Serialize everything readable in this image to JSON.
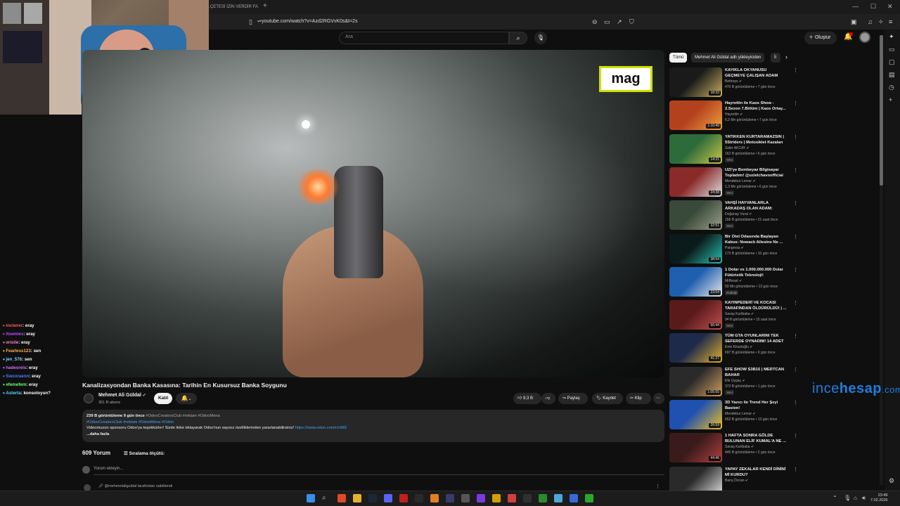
{
  "browser": {
    "tab_title": "YA ÇETESİ İZİN VERDİR FA",
    "url": "youtube.com/watch?v=Azd2RGVvK0s&t=2s"
  },
  "yt_header": {
    "search_placeholder": "Ara",
    "create_label": "Oluştur"
  },
  "chat": [
    {
      "user": "inciwrer",
      "msg": ": eray",
      "color": "#ff5a5a"
    },
    {
      "user": "itsemtex",
      "msg": ": eray",
      "color": "#b44cff"
    },
    {
      "user": "erisile",
      "msg": ": eray",
      "color": "#ff7dd0"
    },
    {
      "user": "Fearless123",
      "msg": ": sen",
      "color": "#ffb14a"
    },
    {
      "user": "jen_576",
      "msg": ": sen",
      "color": "#7ad7ff"
    },
    {
      "user": "hadesreis",
      "msg": ": eray",
      "color": "#d16cff"
    },
    {
      "user": "Swoxraenn",
      "msg": ": eray",
      "color": "#4a7bff"
    },
    {
      "user": "efemefem",
      "msg": ": eray",
      "color": "#6cff6c"
    },
    {
      "user": "Asterta",
      "msg": ": konsoloyun?",
      "color": "#57d8ff"
    }
  ],
  "video": {
    "logo_text": "mag",
    "title": "Kanalizasyondan Banka Kasasına: Tarihin En Kusursuz Banka Soygunu"
  },
  "channel": {
    "name": "Mehmet Ali Güldal",
    "subs": "351 B abone",
    "join_label": "Katıl"
  },
  "actions": {
    "likes": "9,3 B",
    "share": "Paylaş",
    "save": "Kaydet",
    "clip": "Klip"
  },
  "description": {
    "stats": "239 B görüntüleme  9 gün önce",
    "tags_inline": "#OdooCreatorsClub #reklam #OdooMena",
    "tags_line": "#OdooCreatorsClub #reklam #OdooMena #Odoo",
    "text": "Videomuzun sponsoru Odoo'ya teşekkürler! Sizde linke tıklayarak Odoo'nun sayısız özelliklerinden yararlanabilirsiniz!",
    "link": "https://www.odoo.com/r/ctM9",
    "more": "...daha fazla"
  },
  "comments": {
    "count": "609 Yorum",
    "sort_label": "Sıralama ölçütü:",
    "placeholder": "Yorum ekleyin...",
    "pinned": "@mehmetaliguldal tarafından sabitlendi"
  },
  "sidebar": {
    "chips": [
      "Tümü",
      "Mehmet Ali Güldal adlı yükleyiciden",
      "İl"
    ],
    "recs": [
      {
        "title": "KAYIKLA OKYANUSU GEÇMEYE ÇALIŞAN ADAM",
        "channel": "Bettrops",
        "meta": "470 B görüntüleme • 7 gün önce",
        "dur": "18:33",
        "badge": "",
        "c1": "#1a1a1a",
        "c2": "#c9b060"
      },
      {
        "title": "Hayrettin ile Kaos Show - 2.Sezon 7.Bölüm | Kaos Ortay...",
        "channel": "Hayrettin",
        "meta": "6,2 Mn görüntüleme • 7 gün önce",
        "dur": "1:10:49",
        "badge": "",
        "c1": "#b4411e",
        "c2": "#f0a040"
      },
      {
        "title": "YATIKKEN KURTARAMAZSIN | 5Striders | Motosiklet Kazaları ...",
        "channel": "Zafer AKCAY",
        "meta": "162 B görüntüleme • 6 gün önce",
        "dur": "14:21",
        "badge": "Yeni",
        "c1": "#2e6b3a",
        "c2": "#c9c94a"
      },
      {
        "title": "UZI'ye Bembeyaz Bilgisayar Topladım! @uzielchavoofficial",
        "channel": "Mendebur Lemur",
        "meta": "1,3 Mn görüntüleme • 6 gün önce",
        "dur": "24:38",
        "badge": "Yeni",
        "c1": "#8a2a2a",
        "c2": "#e0e0e0"
      },
      {
        "title": "VAHŞİ HAYVANLARLA ARKADAŞ OLAN ADAM: ÇOBA...",
        "channel": "Doğanay Vural",
        "meta": "156 B görüntüleme • 21 saat önce",
        "dur": "32:51",
        "badge": "Yeni",
        "c1": "#3a4a3a",
        "c2": "#9aa08a"
      },
      {
        "title": "Bir Otel Odasında Başlayan Kabus: Nowack Ailesine Ne ...",
        "channel": "Pangresa",
        "meta": "173 B görüntüleme • 10 gün önce",
        "dur": "38:54",
        "badge": "",
        "c1": "#0b1a1a",
        "c2": "#28c0b0"
      },
      {
        "title": "1 Dolar vs 1.000.000.000 Dolar Fütüristik Teknoloji!",
        "channel": "MrBeast",
        "meta": "93 Mn görüntüleme • 13 gün önce",
        "dur": "23:04",
        "badge": "Dublajlı",
        "c1": "#1e5fb0",
        "c2": "#e8e8e8"
      },
      {
        "title": "KAYINPEDERİ VE KOCASI TARAFINDAN ÖLDÜRÜLDÜ! | ...",
        "channel": "Savaş Kurtbaba",
        "meta": "94 B görüntüleme • 15 saat önce",
        "dur": "56:44",
        "badge": "Yeni",
        "c1": "#5a1a1a",
        "c2": "#c05050"
      },
      {
        "title": "TÜM GTA OYUNLARINI TEK SEFERDE OYNADIM! 14 ADET ...",
        "channel": "Emir Kiraztoğlu",
        "meta": "697 B görüntüleme • 9 gün önce",
        "dur": "41:27",
        "badge": "",
        "c1": "#1e2a4a",
        "c2": "#e0b030"
      },
      {
        "title": "EFE SHOW S3B15 | MERTCAN BAHAR",
        "channel": "Efe Uygaç",
        "meta": "372 B görüntüleme • 1 gün önce",
        "dur": "1:05:55",
        "badge": "Yeni",
        "c1": "#2a2a2a",
        "c2": "#d0a060"
      },
      {
        "title": "3D Yazıcı ile Trend Her Şeyi Bastım!",
        "channel": "Mendebur Lemur",
        "meta": "652 B görüntüleme • 13 gün önce",
        "dur": "26:59",
        "badge": "",
        "c1": "#2050b0",
        "c2": "#f0c020"
      },
      {
        "title": "1 HAFTA SONRA GÖLDE BULUNAN ELİF KUMAL'A NE ...",
        "channel": "Savaş Kurtbaba",
        "meta": "445 B görüntüleme • 2 gün önce",
        "dur": "44:46",
        "badge": "",
        "c1": "#3a1a1a",
        "c2": "#b04040"
      },
      {
        "title": "YAPAY ZEKALAR KENDİ DİNİNİ Mİ KURDU?",
        "channel": "Barış Özcan",
        "meta": "",
        "dur": "",
        "badge": "",
        "c1": "#2a2a2a",
        "c2": "#e0e0e0"
      }
    ]
  },
  "watermark": {
    "part1": "ince",
    "part2": "hesap",
    "part3": ".com"
  },
  "clock": {
    "time": "23:49",
    "date": "7.02.2026"
  }
}
